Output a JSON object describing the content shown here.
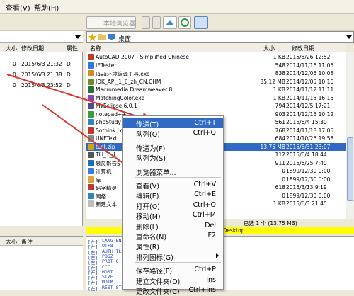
{
  "menubar": {
    "items": [
      "查看(V)",
      "帮助(H)"
    ]
  },
  "toolbar": {
    "local_browser_label": "本地浏览器"
  },
  "left": {
    "columns": [
      "大小",
      "修改日期",
      "属性"
    ],
    "rows": [
      {
        "size": "0",
        "date": "2015/6/3 21:32",
        "attr": "D"
      },
      {
        "size": "0",
        "date": "2015/6/3 21:38",
        "attr": "D"
      },
      {
        "size": "0",
        "date": "2015/6/3 23:52",
        "attr": "D"
      }
    ],
    "bottom_columns": [
      "大小",
      "备注"
    ]
  },
  "right": {
    "path": "桌面",
    "columns": [
      "名称",
      "大小",
      "修改日期"
    ],
    "files": [
      {
        "name": "AutoCAD 2007 - Simplified Chinese",
        "size": "1 KB",
        "date": "2015/5/26 12:52",
        "color": "#c0392b"
      },
      {
        "name": "IETester",
        "size": "548",
        "date": "2014/11/16 11:05",
        "color": "#2e7bd6"
      },
      {
        "name": "Java环境编译工具.exe",
        "size": "838",
        "date": "2014/12/05 10:08",
        "color": "#d68a1e"
      },
      {
        "name": "JDK_API_1_6_zh_CN.CHM",
        "size": "35.12 MB",
        "date": "2014/12/05 10:16",
        "color": "#6b8e23"
      },
      {
        "name": "Macromedia Dreamweaver 8",
        "size": "1 KB",
        "date": "2014/11/12 11:11",
        "color": "#2a6f3a"
      },
      {
        "name": "MatchingColor.exe",
        "size": "1 KB",
        "date": "2014/11/15 16:15",
        "color": "#8e44ad"
      },
      {
        "name": "MyEclipse 6.0.1",
        "size": "794",
        "date": "2014/12/5 17:21",
        "color": "#4b4b8f"
      },
      {
        "name": "notepad++",
        "size": "903",
        "date": "2014/12/15 10:12",
        "color": "#3a9d3a"
      },
      {
        "name": "phpStudy",
        "size": "561",
        "date": "2015/6/4 15:30",
        "color": "#2e86c1"
      },
      {
        "name": "Sothink Lo",
        "size": "768",
        "date": "2014/11/18 17:05",
        "color": "#c0392b"
      },
      {
        "name": "UNFText",
        "size": "684",
        "date": "2014/10/26 19:58",
        "color": "#7f8c8d"
      },
      {
        "name": "test.zip",
        "size": "13.75 MB",
        "date": "2015/5/31 23:07",
        "color": "#d4a017"
      },
      {
        "name": "TLI_1_JJ",
        "size": "112",
        "date": "2015/6/4 18:44",
        "color": "#555555"
      },
      {
        "name": "暴风影音5",
        "size": "911",
        "date": "2015/5/25 7:40",
        "color": "#1f6fb2"
      },
      {
        "name": "计算机",
        "size": "0",
        "date": "1899/12/30 0:00",
        "color": "#3b7dd8"
      },
      {
        "name": "库",
        "size": "0",
        "date": "1899/12/30 0:00",
        "color": "#d9a441"
      },
      {
        "name": "码字精灵",
        "size": "618",
        "date": "2015/3/13 9:19",
        "color": "#c0392b"
      },
      {
        "name": "网络",
        "size": "0",
        "date": "1899/12/30 0:00",
        "color": "#2e86c1"
      },
      {
        "name": "新建文本",
        "size": "1 KB",
        "date": "2015/6/3 21:45",
        "color": "#bdbdbd"
      }
    ],
    "selected_index": 11,
    "status": "已选 1 个 (13.75 MB)",
    "yellow_path": "\\Desktop"
  },
  "log": {
    "lines": [
      {
        "tag": "[左]",
        "text": "LANG EN"
      },
      {
        "tag": "[左]",
        "text": "UTF8"
      },
      {
        "tag": "[左]",
        "text": "AUTH TLS"
      },
      {
        "tag": "[左]",
        "text": "PBSZ"
      },
      {
        "tag": "[左]",
        "text": "PROT C"
      },
      {
        "tag": "[左]",
        "text": "CCC"
      },
      {
        "tag": "[左]",
        "text": "HOST"
      },
      {
        "tag": "[左]",
        "text": "SIZE"
      },
      {
        "tag": "[左]",
        "text": "MDTM"
      },
      {
        "tag": "[左]",
        "text": "REST STR"
      }
    ]
  },
  "context_menu": {
    "items": [
      {
        "label": "传送(T)",
        "shortcut": "Ctrl+T"
      },
      {
        "label": "队列(Q)",
        "shortcut": "Ctrl+Q"
      },
      {
        "label": "传送为(F)",
        "shortcut": ""
      },
      {
        "label": "队列为(S)",
        "shortcut": ""
      },
      {
        "label": "浏览器菜单...",
        "shortcut": ""
      },
      {
        "label": "查看(V)",
        "shortcut": "Ctrl+V"
      },
      {
        "label": "编辑(E)",
        "shortcut": "Ctrl+E"
      },
      {
        "label": "打开(O)",
        "shortcut": "Ctrl+O"
      },
      {
        "label": "移动(M)",
        "shortcut": "Ctrl+M"
      },
      {
        "label": "删除(L)",
        "shortcut": "Del"
      },
      {
        "label": "重命名(N)",
        "shortcut": "F2"
      },
      {
        "label": "属性(R)",
        "shortcut": ""
      },
      {
        "label": "排列图标(G)",
        "shortcut": ""
      },
      {
        "label": "保存路径(P)",
        "shortcut": "Ctrl+P"
      },
      {
        "label": "建立文件夹(D)",
        "shortcut": "Ins"
      },
      {
        "label": "更改文件夹(C)",
        "shortcut": "Ctrl+Ins"
      }
    ]
  }
}
